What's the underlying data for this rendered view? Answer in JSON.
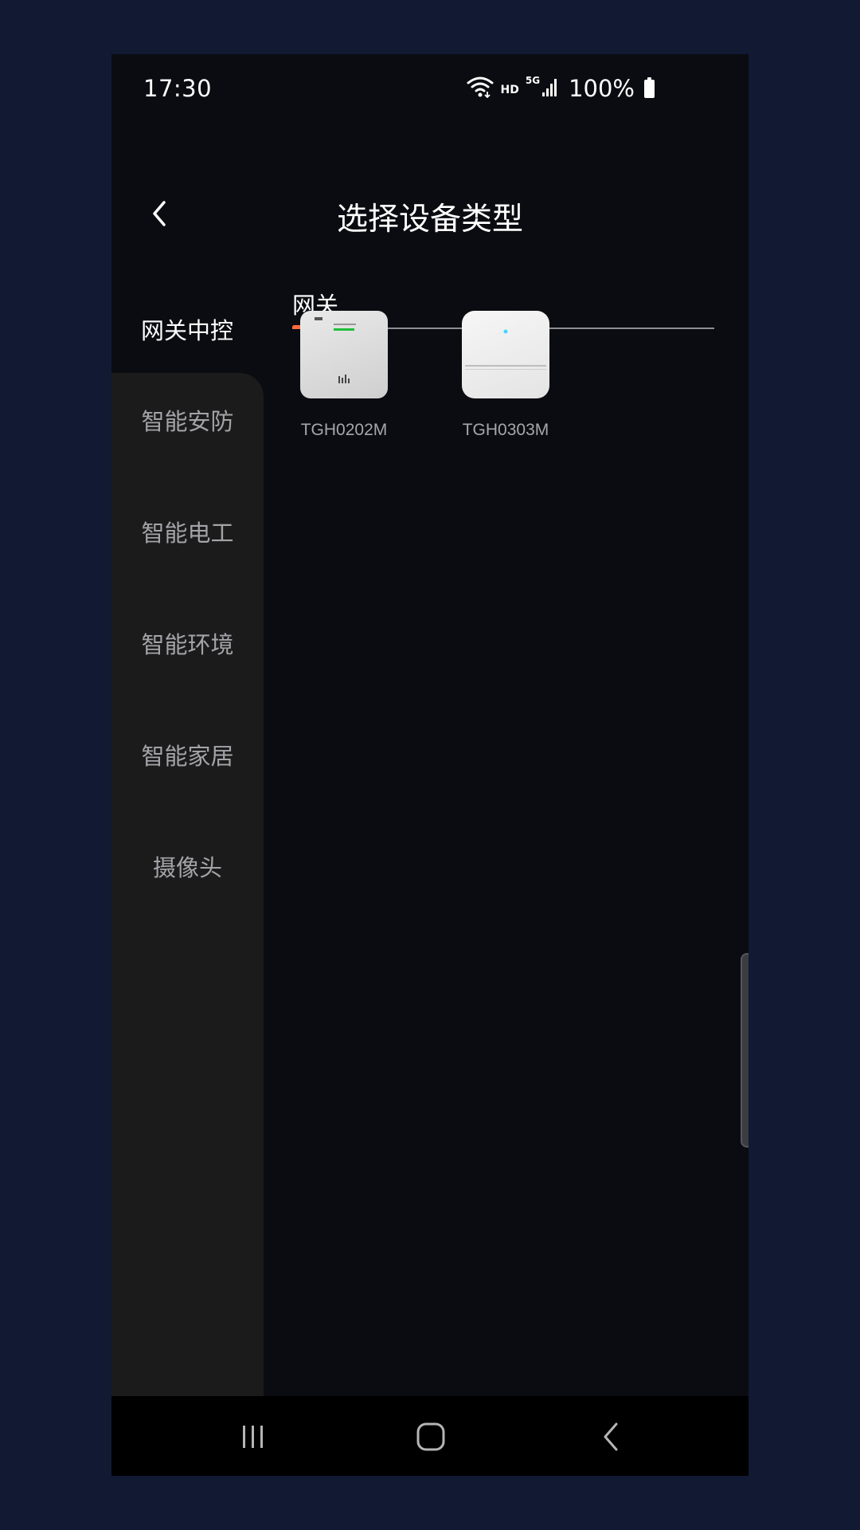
{
  "status_bar": {
    "time": "17:30",
    "hd": "HD",
    "network": "5G",
    "battery": "100%",
    "icons": [
      "wifi-icon",
      "signal-icon",
      "battery-icon"
    ]
  },
  "header": {
    "title": "选择设备类型",
    "back_icon": "chevron-left-icon"
  },
  "sidebar": {
    "items": [
      {
        "label": "网关中控",
        "active": true
      },
      {
        "label": "智能安防",
        "active": false
      },
      {
        "label": "智能电工",
        "active": false
      },
      {
        "label": "智能环境",
        "active": false
      },
      {
        "label": "智能家居",
        "active": false
      },
      {
        "label": "摄像头",
        "active": false
      }
    ]
  },
  "tabs": [
    {
      "label": "网关",
      "active": true
    }
  ],
  "devices": [
    {
      "name": "TGH0202M",
      "image": "gateway-device-image"
    },
    {
      "name": "TGH0303M",
      "image": "gateway-device-image"
    }
  ],
  "nav_bar": {
    "items": [
      "recent-apps-icon",
      "home-icon",
      "back-icon"
    ]
  },
  "colors": {
    "background": "#0b0c11",
    "sidebar": "#1b1b1c",
    "accent": "#ff6a3d",
    "outer": "#121933"
  }
}
